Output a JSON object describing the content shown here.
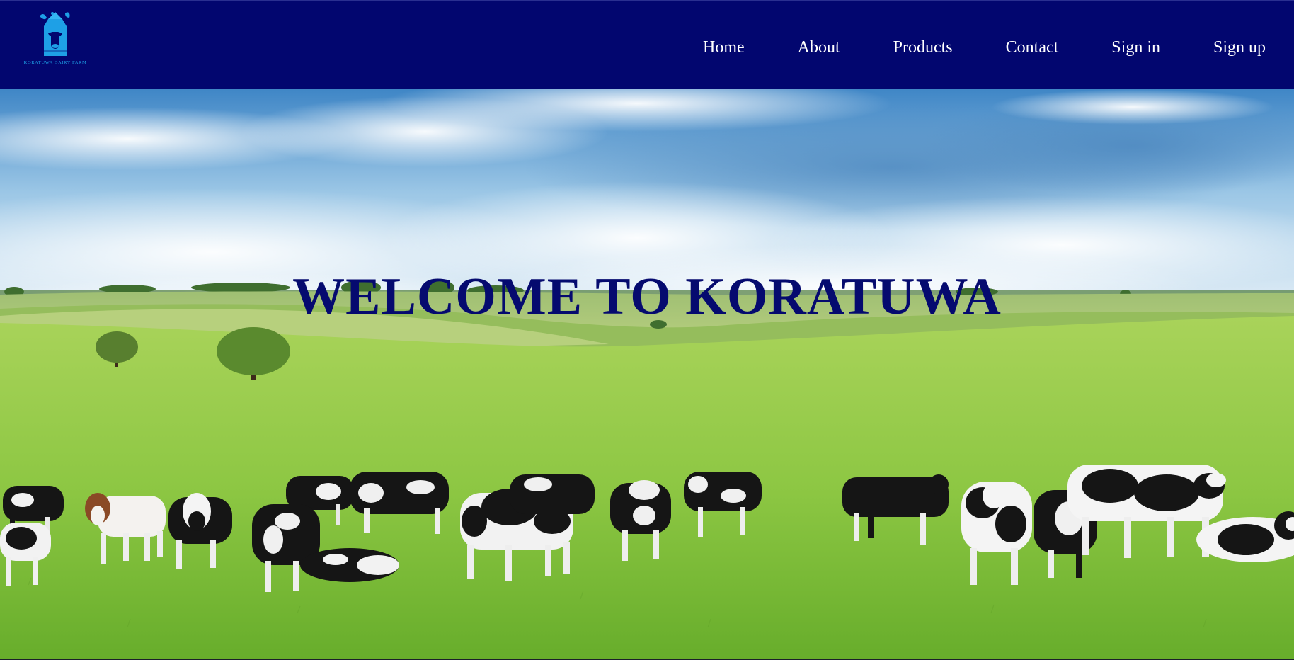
{
  "brand": {
    "name": "KORATUWA DAIRY FARM",
    "logo_icon": "milk-carton-cow-icon",
    "accent_color": "#1ea0e6"
  },
  "header": {
    "background_color": "#02066f"
  },
  "nav": {
    "items": [
      {
        "label": "Home"
      },
      {
        "label": "About"
      },
      {
        "label": "Products"
      },
      {
        "label": "Contact"
      },
      {
        "label": "Sign in"
      },
      {
        "label": "Sign up"
      }
    ]
  },
  "hero": {
    "title": "WELCOME TO KORATUWA",
    "title_color": "#050a6f",
    "image": "cows-grazing-in-green-pasture"
  }
}
